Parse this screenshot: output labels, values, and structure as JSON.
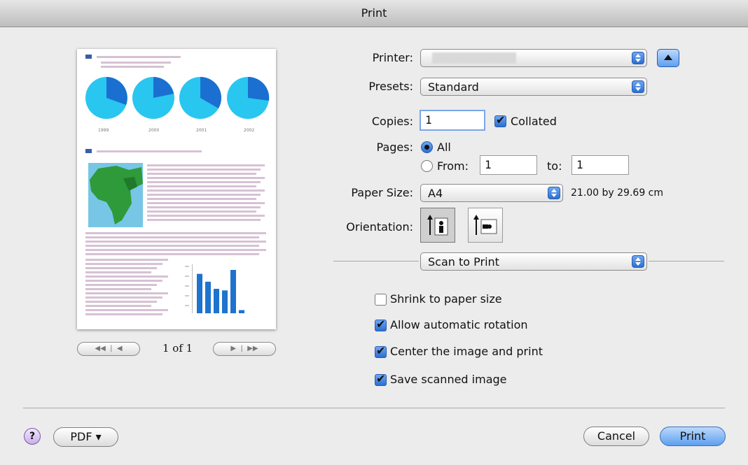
{
  "window": {
    "title": "Print"
  },
  "preview": {
    "page_indicator": "1 of 1",
    "pie_labels": [
      "1999",
      "2000",
      "2001",
      "2002"
    ],
    "bar_values": [
      100,
      80,
      62,
      58,
      110,
      8
    ]
  },
  "printer": {
    "label": "Printer:",
    "value": ""
  },
  "presets": {
    "label": "Presets:",
    "value": "Standard"
  },
  "copies": {
    "label": "Copies:",
    "value": "1",
    "collated_label": "Collated",
    "collated": true
  },
  "pages": {
    "label": "Pages:",
    "all_label": "All",
    "from_label": "From:",
    "from_value": "1",
    "to_label": "to:",
    "to_value": "1",
    "selected": "All"
  },
  "paper": {
    "label": "Paper Size:",
    "value": "A4",
    "dimensions": "21.00 by 29.69 cm"
  },
  "orientation": {
    "label": "Orientation:",
    "selected": "portrait"
  },
  "section": {
    "value": "Scan to Print"
  },
  "options": [
    {
      "label": "Shrink to paper size",
      "checked": false
    },
    {
      "label": "Allow automatic rotation",
      "checked": true
    },
    {
      "label": "Center the image and print",
      "checked": true
    },
    {
      "label": "Save scanned image",
      "checked": true
    }
  ],
  "footer": {
    "help_label": "?",
    "pdf_label": "PDF ▾",
    "cancel_label": "Cancel",
    "print_label": "Print"
  },
  "colors": {
    "accent": "#2b6fd4",
    "pie_light": "#29c6f0",
    "pie_dark": "#1b6fd0",
    "map_green": "#2f9a3a"
  }
}
